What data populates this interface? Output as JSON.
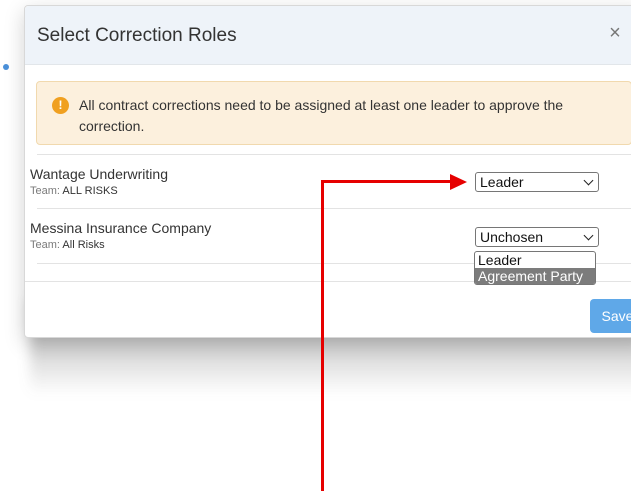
{
  "modal": {
    "title": "Select Correction Roles",
    "close_glyph": "×",
    "alert": {
      "icon": "!",
      "text": "All contract corrections need to be assigned at least one leader to approve the correction."
    },
    "team_label": "Team:",
    "parties": [
      {
        "name": "Wantage Underwriting",
        "team": "ALL RISKS",
        "role": "Leader"
      },
      {
        "name": "Messina Insurance Company",
        "team": "All Risks",
        "role": "Unchosen"
      }
    ],
    "dropdown_options": [
      {
        "label": "Leader",
        "highlighted": false
      },
      {
        "label": "Agreement Party",
        "highlighted": true
      }
    ],
    "save_label": "Save"
  },
  "colors": {
    "header_bg": "#eef3f9",
    "alert_bg": "#fcf0dd",
    "alert_icon": "#f0a020",
    "save_button": "#5fa8e8",
    "annotation_arrow": "#e60000"
  }
}
